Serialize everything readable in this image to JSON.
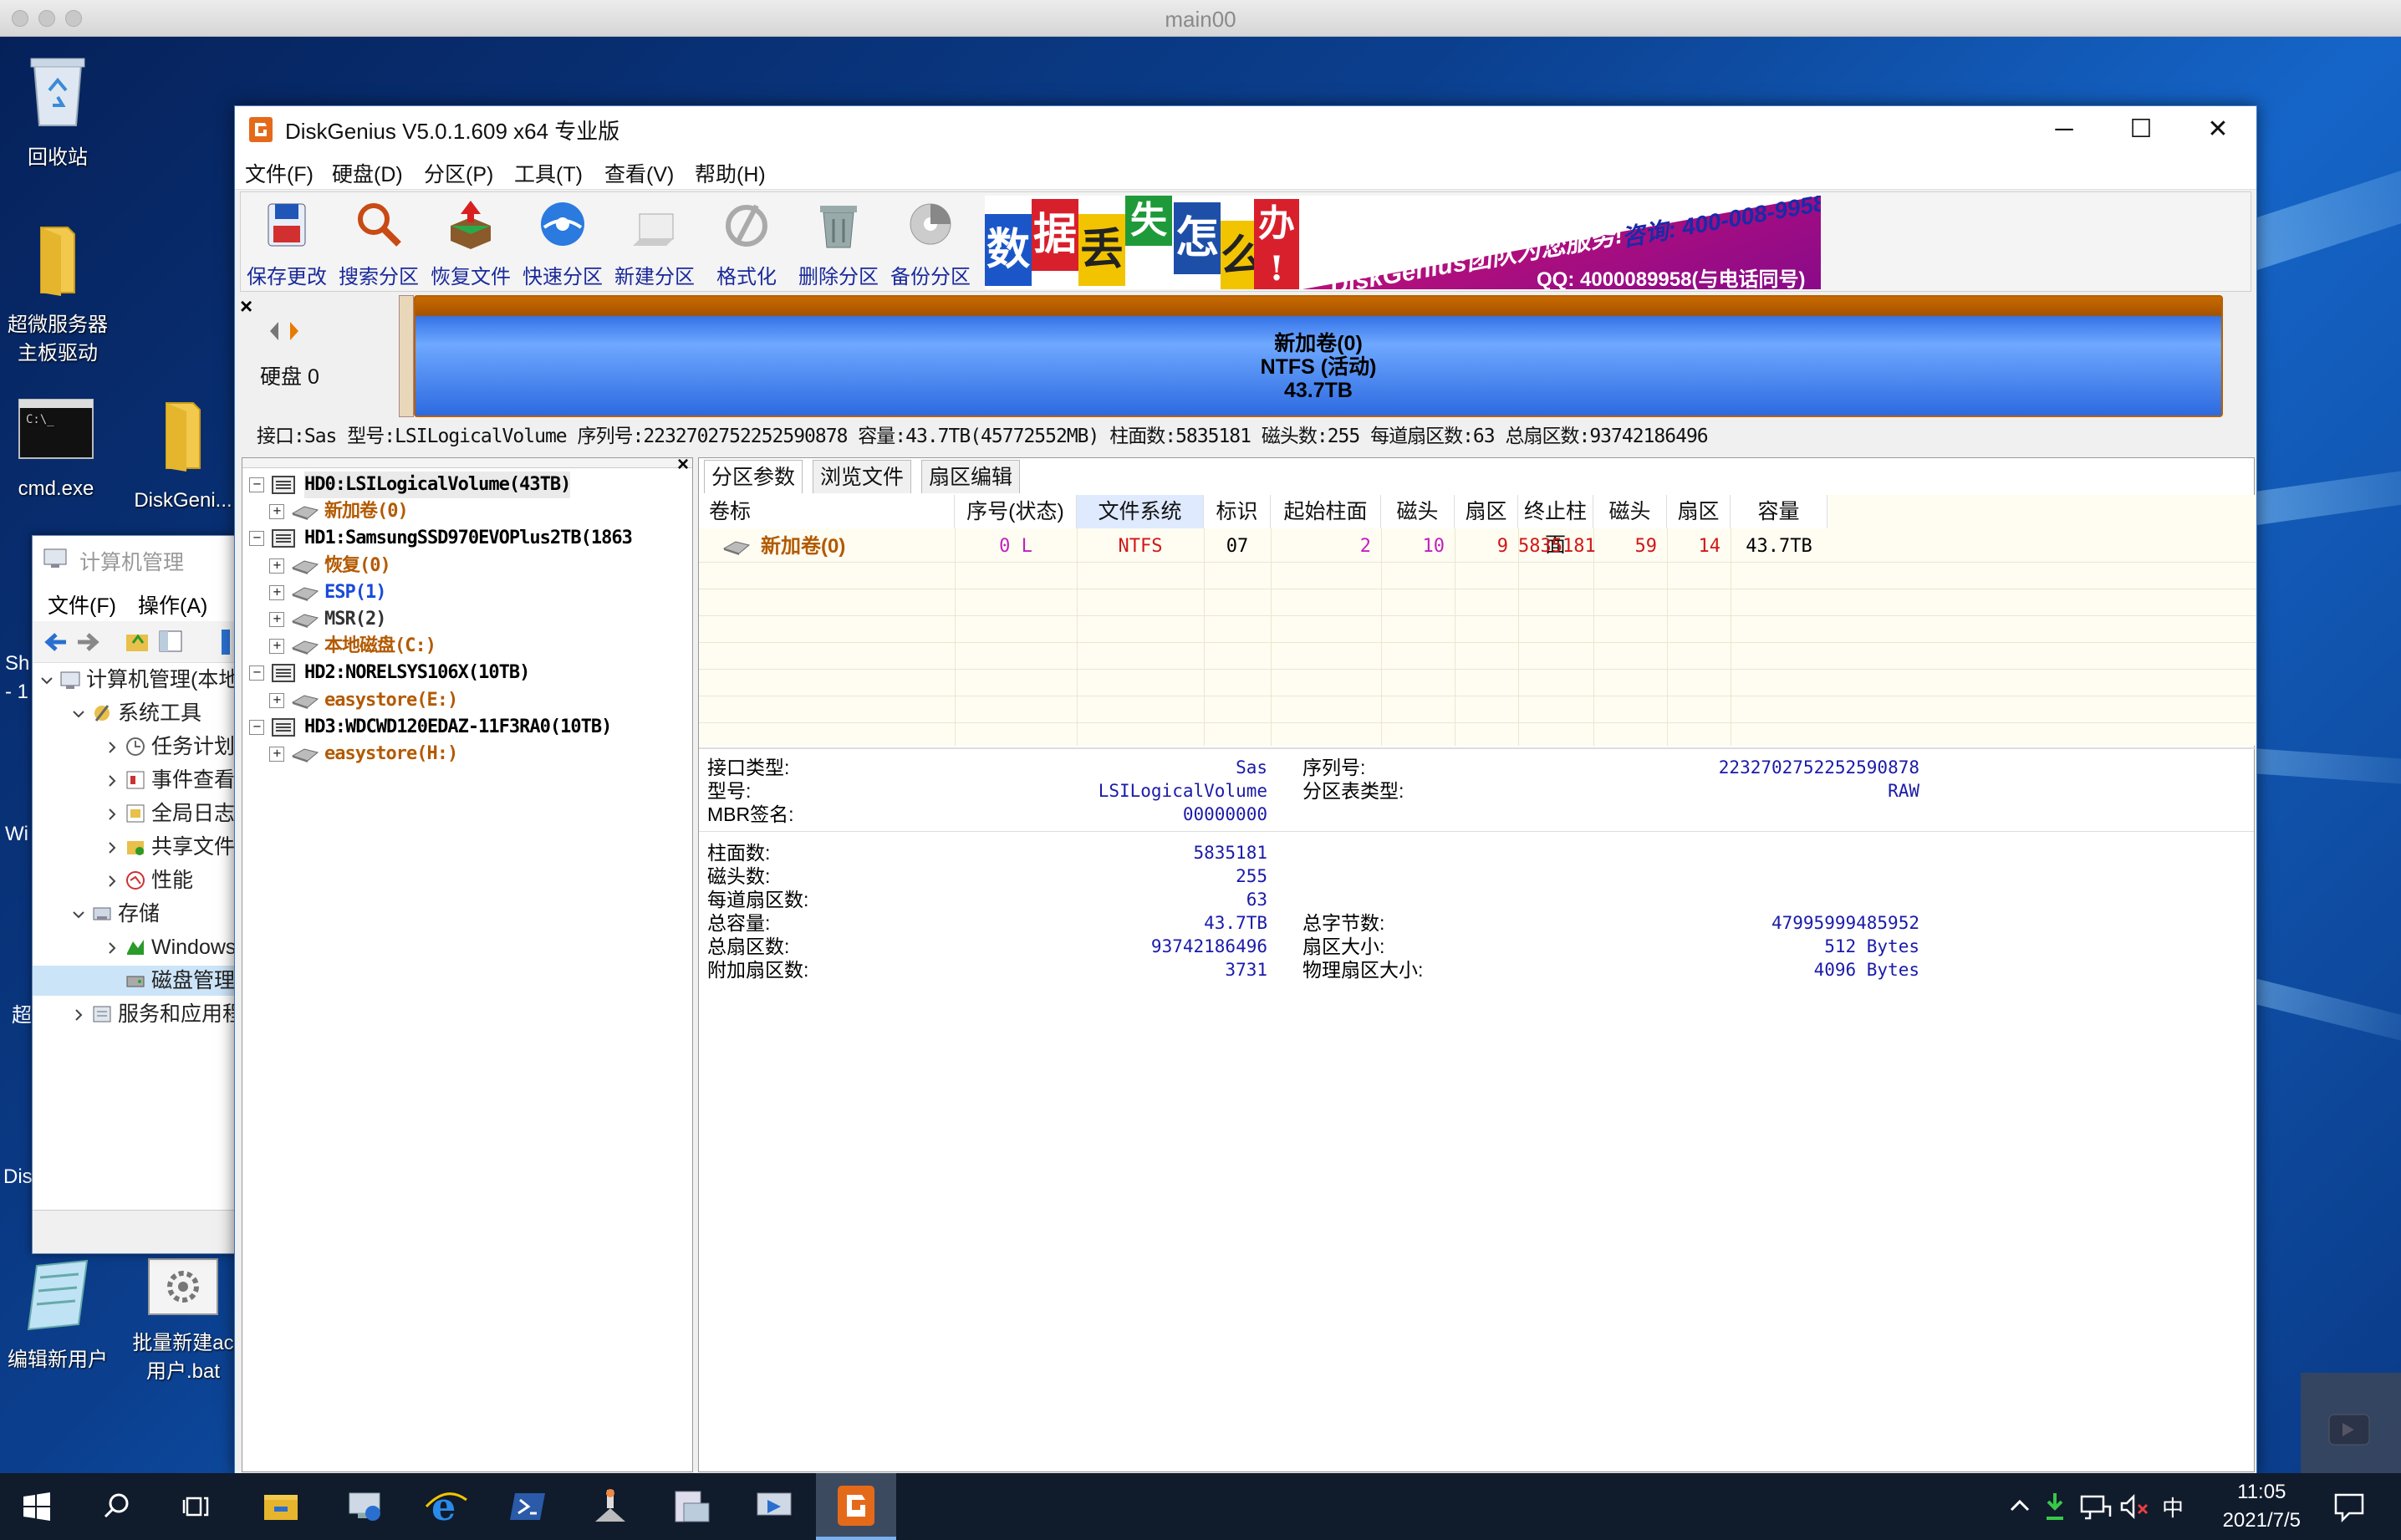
{
  "remote_window": {
    "title": "main00"
  },
  "desktop": {
    "icons": [
      {
        "label": "回收站",
        "icon": "recycle-bin-icon"
      },
      {
        "label": "超微服务器\n主板驱动",
        "icon": "folder-icon"
      },
      {
        "label": "cmd.exe",
        "icon": "cmd-icon"
      },
      {
        "label": "DiskGeni...",
        "icon": "folder-icon"
      },
      {
        "label": "编辑新用户",
        "icon": "notepad-icon"
      },
      {
        "label": "批量新建ac\n用户.bat",
        "icon": "bat-gear-icon"
      }
    ],
    "edge_fragments": [
      "Sh",
      "- 1",
      "Wi",
      "超",
      "Dis"
    ]
  },
  "computer_management": {
    "title": "计算机管理",
    "menu": [
      "文件(F)",
      "操作(A)"
    ],
    "tree": [
      {
        "label": "计算机管理(本地)",
        "level": 0
      },
      {
        "label": "系统工具",
        "level": 1
      },
      {
        "label": "任务计划程",
        "level": 2
      },
      {
        "label": "事件查看器",
        "level": 2
      },
      {
        "label": "全局日志",
        "level": 2
      },
      {
        "label": "共享文件夹",
        "level": 2
      },
      {
        "label": "性能",
        "level": 2
      },
      {
        "label": "存储",
        "level": 1
      },
      {
        "label": "Windows",
        "level": 2
      },
      {
        "label": "磁盘管理",
        "level": 2
      },
      {
        "label": "服务和应用程",
        "level": 1
      }
    ]
  },
  "diskgenius": {
    "title": "DiskGenius V5.0.1.609 x64 专业版",
    "menu": [
      "文件(F)",
      "硬盘(D)",
      "分区(P)",
      "工具(T)",
      "查看(V)",
      "帮助(H)"
    ],
    "toolbar": [
      "保存更改",
      "搜索分区",
      "恢复文件",
      "快速分区",
      "新建分区",
      "格式化",
      "删除分区",
      "备份分区"
    ],
    "banner": {
      "chars": [
        "数",
        "据",
        "丢",
        "失",
        "怎",
        "么",
        "办",
        "!"
      ],
      "slogan": "DiskGenius团队为您服务!",
      "phone": "咨询: 400-008-9958",
      "qq": "QQ: 4000089958(与电话同号)"
    },
    "disk_nav": {
      "disk_label": "硬盘 0"
    },
    "partition_bar": {
      "name": "新加卷(0)",
      "fs": "NTFS (活动)",
      "size": "43.7TB"
    },
    "disk_info": "接口:Sas  型号:LSILogicalVolume  序列号:2232702752252590878  容量:43.7TB(45772552MB)  柱面数:5835181  磁头数:255  每道扇区数:63  总扇区数:93742186496",
    "tree": [
      {
        "label": "HD0:LSILogicalVolume(43TB)",
        "level": 0,
        "type": "disk"
      },
      {
        "label": "新加卷(0)",
        "level": 1,
        "type": "part-orange"
      },
      {
        "label": "HD1:SamsungSSD970EVOPlus2TB(1863",
        "level": 0,
        "type": "disk"
      },
      {
        "label": "恢复(0)",
        "level": 1,
        "type": "part-orange"
      },
      {
        "label": "ESP(1)",
        "level": 1,
        "type": "part-blue"
      },
      {
        "label": "MSR(2)",
        "level": 1,
        "type": "part-gray"
      },
      {
        "label": "本地磁盘(C:)",
        "level": 1,
        "type": "part-orange"
      },
      {
        "label": "HD2:NORELSYS106X(10TB)",
        "level": 0,
        "type": "disk"
      },
      {
        "label": "easystore(E:)",
        "level": 1,
        "type": "part-orange"
      },
      {
        "label": "HD3:WDCWD120EDAZ-11F3RA0(10TB)",
        "level": 0,
        "type": "disk"
      },
      {
        "label": "easystore(H:)",
        "level": 1,
        "type": "part-orange"
      }
    ],
    "tabs": [
      "分区参数",
      "浏览文件",
      "扇区编辑"
    ],
    "table": {
      "headers": [
        "卷标",
        "序号(状态)",
        "文件系统",
        "标识",
        "起始柱面",
        "磁头",
        "扇区",
        "终止柱面",
        "磁头",
        "扇区",
        "容量"
      ],
      "rows": [
        [
          "新加卷(0)",
          "0 L",
          "NTFS",
          "07",
          "2",
          "10",
          "9",
          "5835181",
          "59",
          "14",
          "43.7TB"
        ]
      ]
    },
    "details_left": [
      {
        "label": "接口类型:",
        "value": "Sas"
      },
      {
        "label": "型号:",
        "value": "LSILogicalVolume"
      },
      {
        "label": "MBR签名:",
        "value": "00000000"
      }
    ],
    "details_right": [
      {
        "label": "序列号:",
        "value": "2232702752252590878"
      },
      {
        "label": "分区表类型:",
        "value": "RAW"
      }
    ],
    "geometry_left": [
      {
        "label": "柱面数:",
        "value": "5835181"
      },
      {
        "label": "磁头数:",
        "value": "255"
      },
      {
        "label": "每道扇区数:",
        "value": "63"
      },
      {
        "label": "总容量:",
        "value": "43.7TB"
      },
      {
        "label": "总扇区数:",
        "value": "93742186496"
      },
      {
        "label": "附加扇区数:",
        "value": "3731"
      }
    ],
    "geometry_right": [
      {
        "label": "总字节数:",
        "value": "47995999485952"
      },
      {
        "label": "扇区大小:",
        "value": "512 Bytes"
      },
      {
        "label": "物理扇区大小:",
        "value": "4096 Bytes"
      }
    ]
  },
  "taskbar": {
    "time": "11:05",
    "date": "2021/7/5",
    "ime": "中"
  }
}
